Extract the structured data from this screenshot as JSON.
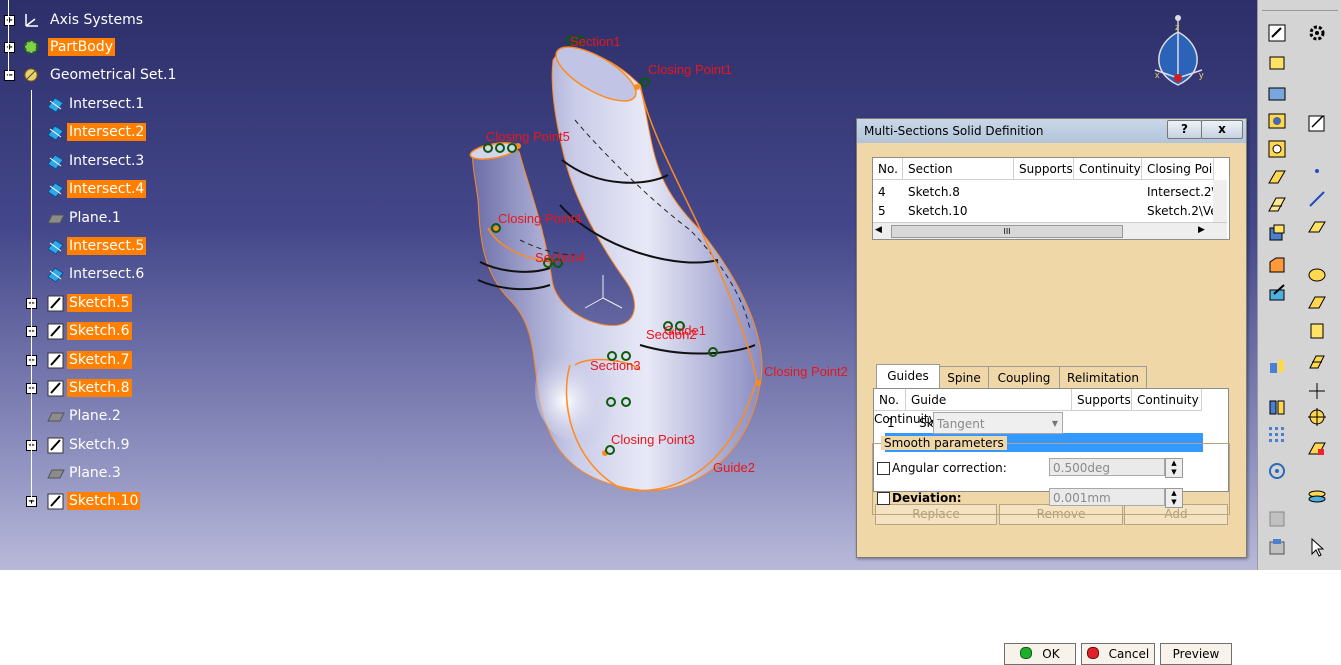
{
  "tree": {
    "nodes": [
      {
        "label": "Axis Systems",
        "selected": false,
        "icon": "axis-system-icon"
      },
      {
        "label": "PartBody",
        "selected": true,
        "icon": "partbody-gear-icon"
      },
      {
        "label": "Geometrical Set.1",
        "selected": false,
        "icon": "geometrical-set-icon"
      },
      {
        "label": "Intersect.1",
        "selected": false,
        "icon": "intersect-icon"
      },
      {
        "label": "Intersect.2",
        "selected": true,
        "icon": "intersect-icon"
      },
      {
        "label": "Intersect.3",
        "selected": false,
        "icon": "intersect-icon"
      },
      {
        "label": "Intersect.4",
        "selected": true,
        "icon": "intersect-icon"
      },
      {
        "label": "Plane.1",
        "selected": false,
        "icon": "plane-icon"
      },
      {
        "label": "Intersect.5",
        "selected": true,
        "icon": "intersect-icon"
      },
      {
        "label": "Intersect.6",
        "selected": false,
        "icon": "intersect-icon"
      },
      {
        "label": "Sketch.5",
        "selected": true,
        "icon": "sketch-icon"
      },
      {
        "label": "Sketch.6",
        "selected": true,
        "icon": "sketch-icon"
      },
      {
        "label": "Sketch.7",
        "selected": true,
        "icon": "sketch-icon"
      },
      {
        "label": "Sketch.8",
        "selected": true,
        "icon": "sketch-icon"
      },
      {
        "label": "Plane.2",
        "selected": false,
        "icon": "plane-icon"
      },
      {
        "label": "Sketch.9",
        "selected": false,
        "icon": "sketch-icon"
      },
      {
        "label": "Plane.3",
        "selected": false,
        "icon": "plane-icon"
      },
      {
        "label": "Sketch.10",
        "selected": true,
        "icon": "sketch-icon"
      }
    ]
  },
  "viewport": {
    "labels": {
      "section1": "Section1",
      "closing_point1": "Closing Point1",
      "closing_point5": "Closing Point5",
      "closing_point4": "Closing Point4",
      "section4": "Section4",
      "guide1": "Guide1",
      "section2": "Section2",
      "closing_point2": "Closing Point2",
      "section3": "Section3",
      "closing_point3": "Closing Point3",
      "guide2": "Guide2"
    },
    "compass_axes": {
      "x": "x",
      "y": "y",
      "z": "z"
    }
  },
  "dialog": {
    "title": "Multi-Sections Solid Definition",
    "help_label": "?",
    "close_label": "x",
    "sections_table": {
      "headers": [
        "No.",
        "Section",
        "Supports",
        "Continuity",
        "Closing Poi"
      ],
      "rows": [
        [
          "4",
          "Sketch.8",
          "",
          "",
          "Intersect.2\\"
        ],
        [
          "5",
          "Sketch.10",
          "",
          "",
          "Sketch.2\\Ve"
        ]
      ],
      "hscroll_grip": "III"
    },
    "tabs": [
      "Guides",
      "Spine",
      "Coupling",
      "Relimitation"
    ],
    "guides_table": {
      "headers": [
        "No.",
        "Guide",
        "Supports",
        "Continuity"
      ],
      "rows": [
        [
          "1",
          "Sketch.3",
          "",
          ""
        ],
        [
          "2",
          "Sketch.2",
          "",
          ""
        ]
      ]
    },
    "buttons": {
      "replace": "Replace",
      "remove": "Remove",
      "add": "Add",
      "ok": "OK",
      "cancel": "Cancel",
      "preview": "Preview"
    },
    "continuity_label": "Continuity:",
    "continuity_value": "Tangent",
    "smooth_title": "Smooth parameters",
    "angular_label": "Angular correction:",
    "angular_value": "0.500deg",
    "deviation_label": "Deviation:",
    "deviation_value": "0.001mm"
  },
  "colors": {
    "selection": "#ff8000",
    "highlight_row": "#3399ff",
    "dialog_bg": "#f0d7a8",
    "annotation_red": "#e8161c"
  }
}
